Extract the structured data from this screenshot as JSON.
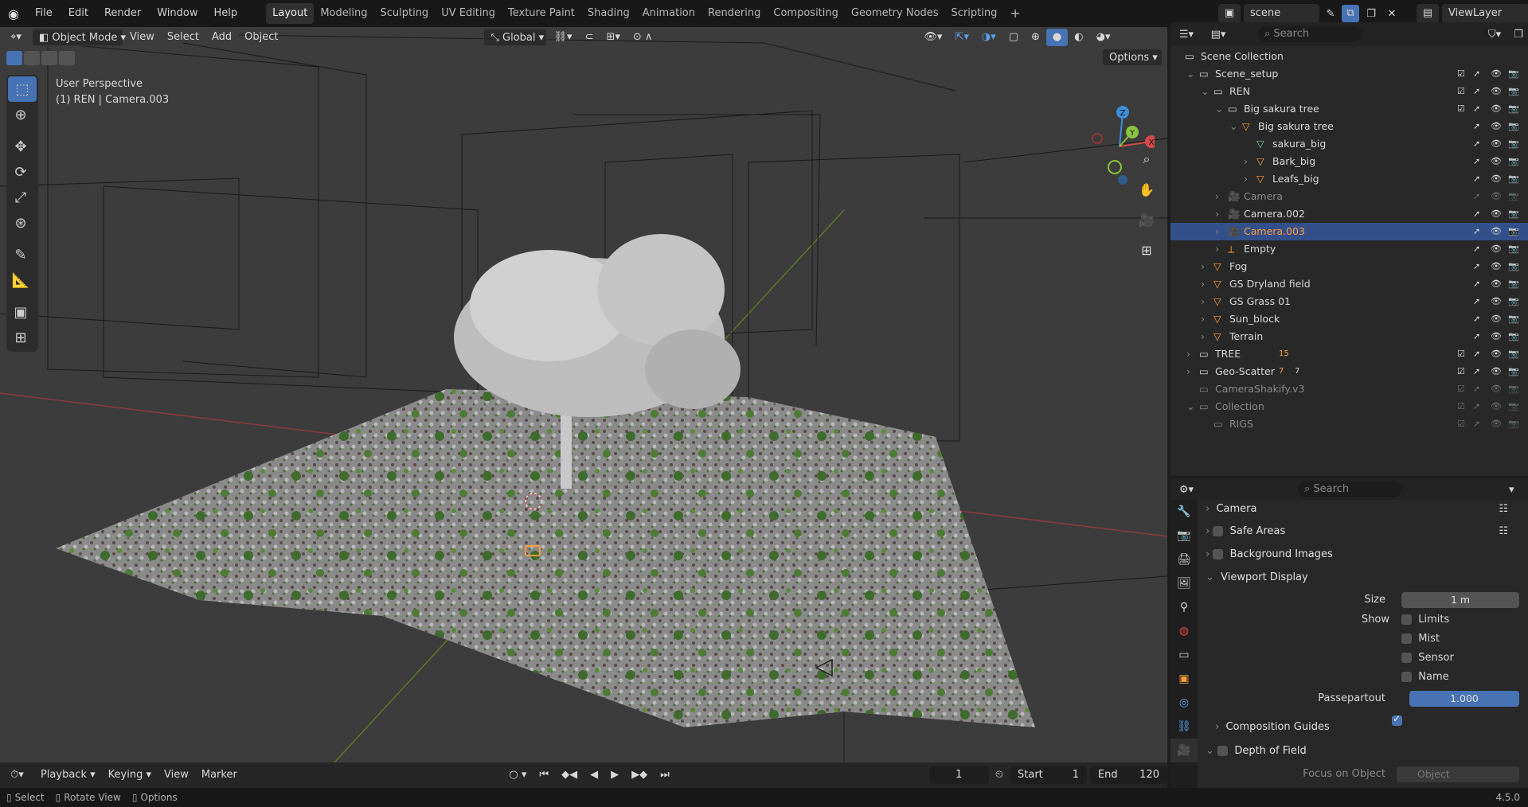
{
  "topbar": {
    "menus": [
      "File",
      "Edit",
      "Render",
      "Window",
      "Help"
    ],
    "workspaces": [
      "Layout",
      "Modeling",
      "Sculpting",
      "UV Editing",
      "Texture Paint",
      "Shading",
      "Animation",
      "Rendering",
      "Compositing",
      "Geometry Nodes",
      "Scripting"
    ],
    "active_workspace": "Layout",
    "add_tab": "+",
    "scene_name": "scene",
    "view_layer": "ViewLayer"
  },
  "viewport": {
    "mode": "Object Mode",
    "menus": [
      "View",
      "Select",
      "Add",
      "Object"
    ],
    "transform_orientation": "Global",
    "options_label": "Options",
    "overlay_title": "User Perspective",
    "overlay_subtitle": "(1) REN | Camera.003",
    "gizmo_axes": {
      "x": "X",
      "y": "Y",
      "z": "Z"
    }
  },
  "timeline": {
    "menus": [
      "Playback",
      "Keying",
      "View",
      "Marker"
    ],
    "current_frame": "1",
    "start_label": "Start",
    "start_value": "1",
    "end_label": "End",
    "end_value": "120"
  },
  "statusbar": {
    "select": "Select",
    "rotate": "Rotate View",
    "options": "Options",
    "version": "4.5.0"
  },
  "outliner": {
    "search_placeholder": "Search",
    "rows": [
      {
        "label": "Scene Collection",
        "indent": 0
      },
      {
        "label": "Scene_setup",
        "indent": 1
      },
      {
        "label": "REN",
        "indent": 2
      },
      {
        "label": "Big sakura tree",
        "indent": 3
      },
      {
        "label": "Big sakura tree",
        "indent": 4
      },
      {
        "label": "sakura_big",
        "indent": 5
      },
      {
        "label": "Bark_big",
        "indent": 5
      },
      {
        "label": "Leafs_big",
        "indent": 5
      },
      {
        "label": "Camera",
        "indent": 3
      },
      {
        "label": "Camera.002",
        "indent": 3
      },
      {
        "label": "Camera.003",
        "indent": 3
      },
      {
        "label": "Empty",
        "indent": 3
      },
      {
        "label": "Fog",
        "indent": 2
      },
      {
        "label": "GS Dryland field",
        "indent": 2
      },
      {
        "label": "GS Grass 01",
        "indent": 2
      },
      {
        "label": "Sun_block",
        "indent": 2
      },
      {
        "label": "Terrain",
        "indent": 2
      },
      {
        "label": "TREE",
        "indent": 1
      },
      {
        "label": "Geo-Scatter",
        "indent": 1
      },
      {
        "label": "CameraShakify.v3",
        "indent": 1
      },
      {
        "label": "Collection",
        "indent": 1
      },
      {
        "label": "RIGS",
        "indent": 2
      }
    ],
    "tree_badge": "15",
    "geo_badge_1": "7",
    "geo_badge_2": "7"
  },
  "properties": {
    "search_placeholder": "Search",
    "camera_section": "Camera",
    "safe_areas": "Safe Areas",
    "background_images": "Background Images",
    "viewport_display": "Viewport Display",
    "size_label": "Size",
    "size_value": "1 m",
    "show_label": "Show",
    "limits": "Limits",
    "mist": "Mist",
    "sensor": "Sensor",
    "name": "Name",
    "passepartout_label": "Passepartout",
    "passepartout_value": "1.000",
    "composition_guides": "Composition Guides",
    "depth_of_field": "Depth of Field",
    "focus_label": "Focus on Object",
    "focus_placeholder": "Object"
  },
  "colors": {
    "accent": "#4772b3",
    "selected_row": "#34508a",
    "selected_text": "#ff9d3b",
    "axis_x": "#d44a4a",
    "axis_y": "#8ac43c",
    "axis_z": "#3b8fd9"
  }
}
